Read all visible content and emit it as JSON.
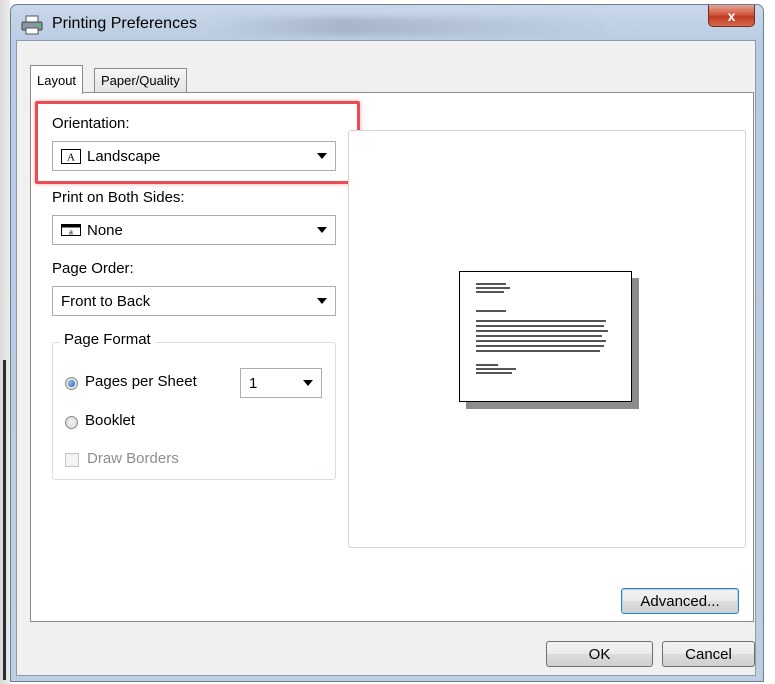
{
  "window": {
    "title": "Printing Preferences",
    "close_glyph": "x",
    "title_icon": "printer-icon"
  },
  "tabs": [
    {
      "label": "Layout",
      "active": true
    },
    {
      "label": "Paper/Quality",
      "active": false
    }
  ],
  "orientation": {
    "label": "Orientation:",
    "value": "Landscape",
    "icon": "landscape-page-icon",
    "icon_glyph": "A"
  },
  "duplex": {
    "label": "Print on Both Sides:",
    "value": "None",
    "icon": "duplex-page-icon",
    "icon_glyph": "a"
  },
  "page_order": {
    "label": "Page Order:",
    "value": "Front to Back"
  },
  "page_format": {
    "title": "Page Format",
    "pages_per_sheet_label": "Pages per Sheet",
    "pages_per_sheet_value": "1",
    "pages_per_sheet_checked": true,
    "booklet_label": "Booklet",
    "booklet_checked": false,
    "draw_borders_label": "Draw Borders",
    "draw_borders_enabled": false
  },
  "buttons": {
    "advanced": "Advanced...",
    "ok": "OK",
    "cancel": "Cancel"
  },
  "colors": {
    "highlight": "#e84d52",
    "close_button": "#c13a20",
    "focus_border": "#3c7fb1"
  }
}
